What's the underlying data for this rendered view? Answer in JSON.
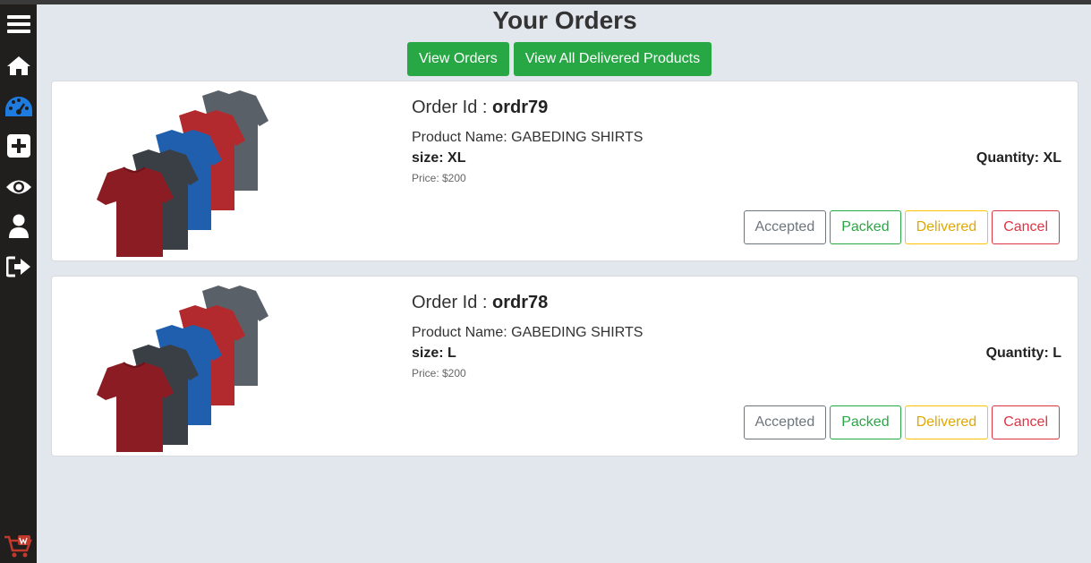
{
  "page": {
    "title": "Your Orders"
  },
  "toolbar": {
    "view_orders": "View Orders",
    "view_delivered": "View All Delivered Products"
  },
  "sidebar": {
    "icons": [
      "menu-icon",
      "home-icon",
      "dashboard-icon",
      "add-icon",
      "eye-icon",
      "user-icon",
      "logout-icon"
    ],
    "logo": "cart-logo"
  },
  "orders": [
    {
      "order_id_label": "Order Id : ",
      "order_id": "ordr79",
      "product_name": "Product Name: GABEDING SHIRTS",
      "size": "size: XL",
      "quantity": "Quantity: XL",
      "price": "Price: $200",
      "buttons": {
        "accepted": "Accepted",
        "packed": "Packed",
        "delivered": "Delivered",
        "cancel": "Cancel"
      }
    },
    {
      "order_id_label": "Order Id : ",
      "order_id": "ordr78",
      "product_name": "Product Name: GABEDING SHIRTS",
      "size": "size: L",
      "quantity": "Quantity: L",
      "price": "Price: $200",
      "buttons": {
        "accepted": "Accepted",
        "packed": "Packed",
        "delivered": "Delivered",
        "cancel": "Cancel"
      }
    }
  ],
  "colors": {
    "accent_green": "#28a745",
    "sidebar_bg": "#211e1e",
    "page_bg": "#e2e7ee",
    "dashboard_icon": "#1e7be0"
  }
}
